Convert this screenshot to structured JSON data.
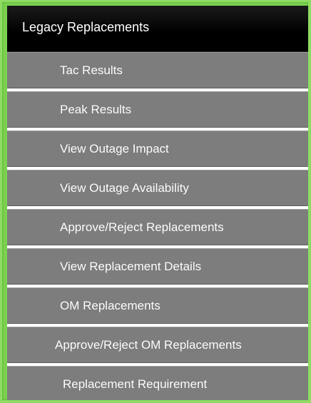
{
  "menu": {
    "header": "Legacy Replacements",
    "items": [
      {
        "label": "Tac Results"
      },
      {
        "label": "Peak Results"
      },
      {
        "label": "View Outage Impact"
      },
      {
        "label": "View Outage Availability"
      },
      {
        "label": "Approve/Reject Replacements"
      },
      {
        "label": "View Replacement Details"
      },
      {
        "label": "OM Replacements"
      },
      {
        "label": "Approve/Reject OM Replacements"
      },
      {
        "label": "Replacement Requirement"
      }
    ]
  }
}
